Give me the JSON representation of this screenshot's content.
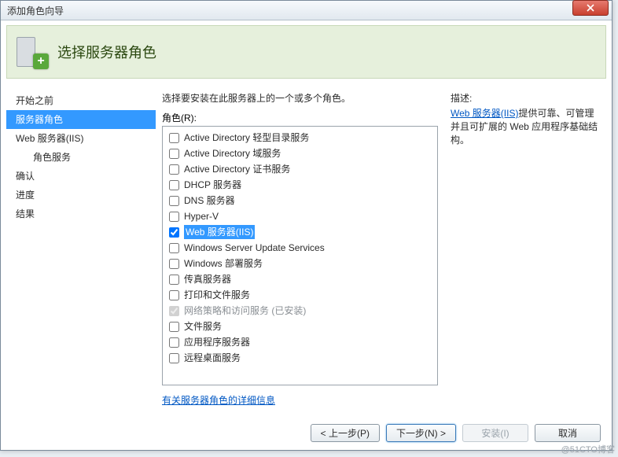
{
  "window": {
    "title": "添加角色向导"
  },
  "header": {
    "title": "选择服务器角色"
  },
  "sidebar": {
    "items": [
      {
        "label": "开始之前",
        "indent": false,
        "active": false
      },
      {
        "label": "服务器角色",
        "indent": false,
        "active": true
      },
      {
        "label": "Web 服务器(IIS)",
        "indent": false,
        "active": false
      },
      {
        "label": "角色服务",
        "indent": true,
        "active": false
      },
      {
        "label": "确认",
        "indent": false,
        "active": false
      },
      {
        "label": "进度",
        "indent": false,
        "active": false
      },
      {
        "label": "结果",
        "indent": false,
        "active": false
      }
    ]
  },
  "main": {
    "instruction": "选择要安装在此服务器上的一个或多个角色。",
    "roles_label": "角色(R):",
    "roles": [
      {
        "label": "Active Directory 轻型目录服务",
        "checked": false,
        "disabled": false,
        "selected": false
      },
      {
        "label": "Active Directory 域服务",
        "checked": false,
        "disabled": false,
        "selected": false
      },
      {
        "label": "Active Directory 证书服务",
        "checked": false,
        "disabled": false,
        "selected": false
      },
      {
        "label": "DHCP 服务器",
        "checked": false,
        "disabled": false,
        "selected": false
      },
      {
        "label": "DNS 服务器",
        "checked": false,
        "disabled": false,
        "selected": false
      },
      {
        "label": "Hyper-V",
        "checked": false,
        "disabled": false,
        "selected": false
      },
      {
        "label": "Web 服务器(IIS)",
        "checked": true,
        "disabled": false,
        "selected": true
      },
      {
        "label": "Windows Server Update Services",
        "checked": false,
        "disabled": false,
        "selected": false
      },
      {
        "label": "Windows 部署服务",
        "checked": false,
        "disabled": false,
        "selected": false
      },
      {
        "label": "传真服务器",
        "checked": false,
        "disabled": false,
        "selected": false
      },
      {
        "label": "打印和文件服务",
        "checked": false,
        "disabled": false,
        "selected": false
      },
      {
        "label": "网络策略和访问服务  (已安装)",
        "checked": true,
        "disabled": true,
        "selected": false
      },
      {
        "label": "文件服务",
        "checked": false,
        "disabled": false,
        "selected": false
      },
      {
        "label": "应用程序服务器",
        "checked": false,
        "disabled": false,
        "selected": false
      },
      {
        "label": "远程桌面服务",
        "checked": false,
        "disabled": false,
        "selected": false
      }
    ],
    "more_link": "有关服务器角色的详细信息"
  },
  "right": {
    "title": "描述:",
    "desc_link": "Web 服务器(IIS)",
    "desc_tail": "提供可靠、可管理并且可扩展的 Web 应用程序基础结构。"
  },
  "footer": {
    "prev": "< 上一步(P)",
    "next": "下一步(N) >",
    "install": "安装(I)",
    "cancel": "取消"
  },
  "watermark": "@51CTO博客"
}
